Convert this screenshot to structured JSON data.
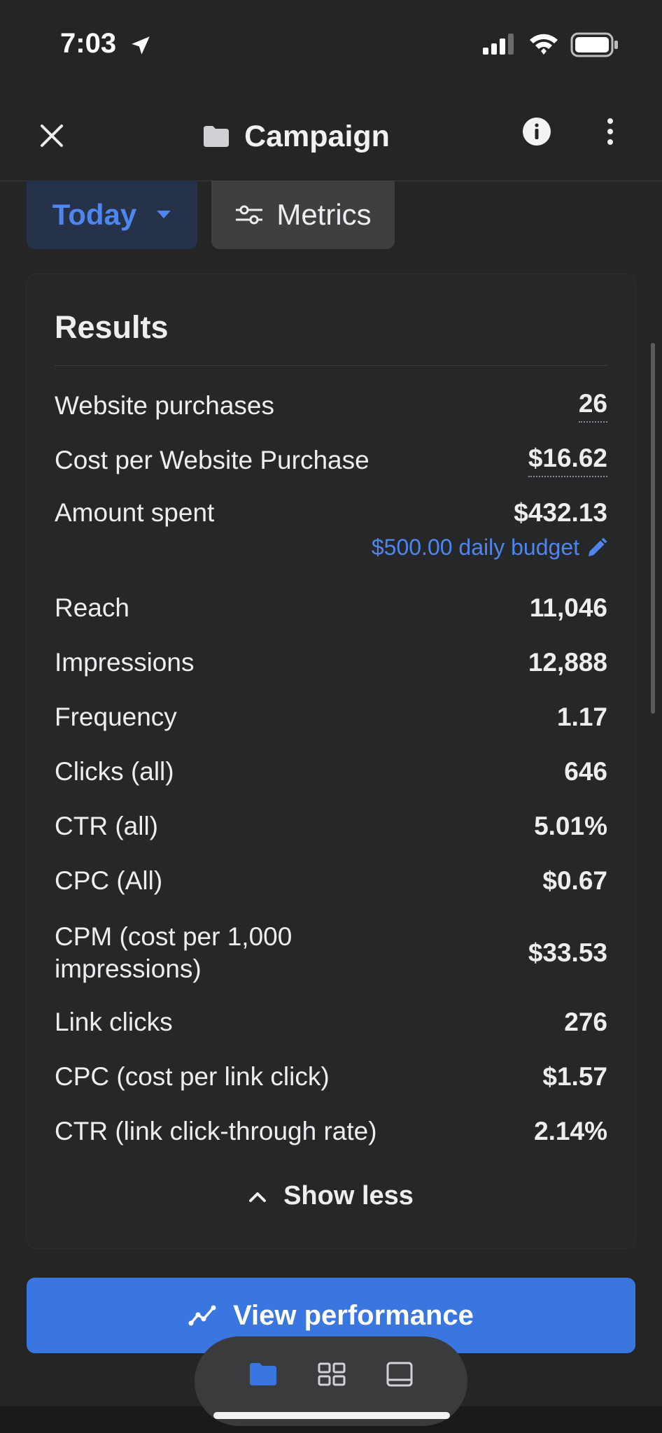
{
  "status_bar": {
    "time": "7:03"
  },
  "header": {
    "title": "Campaign"
  },
  "filters": {
    "date_label": "Today",
    "metrics_label": "Metrics"
  },
  "results": {
    "title": "Results",
    "budget_text": "$500.00 daily budget",
    "rows": [
      {
        "label": "Website purchases",
        "value": "26"
      },
      {
        "label": "Cost per Website Purchase",
        "value": "$16.62"
      },
      {
        "label": "Amount spent",
        "value": "$432.13"
      },
      {
        "label": "Reach",
        "value": "11,046"
      },
      {
        "label": "Impressions",
        "value": "12,888"
      },
      {
        "label": "Frequency",
        "value": "1.17"
      },
      {
        "label": "Clicks (all)",
        "value": "646"
      },
      {
        "label": "CTR (all)",
        "value": "5.01%"
      },
      {
        "label": "CPC (All)",
        "value": "$0.67"
      },
      {
        "label": "CPM (cost per 1,000 impressions)",
        "value": "$33.53"
      },
      {
        "label": "Link clicks",
        "value": "276"
      },
      {
        "label": "CPC (cost per link click)",
        "value": "$1.57"
      },
      {
        "label": "CTR (link click-through rate)",
        "value": "2.14%"
      }
    ],
    "show_less_label": "Show less"
  },
  "actions": {
    "view_performance_label": "View performance"
  },
  "colors": {
    "accent": "#3a76e0",
    "link": "#4f86ee",
    "background": "#252526"
  },
  "tabbar": {
    "icons": [
      "folder-icon",
      "grid-icon",
      "tablet-icon"
    ],
    "active": "folder-icon"
  }
}
